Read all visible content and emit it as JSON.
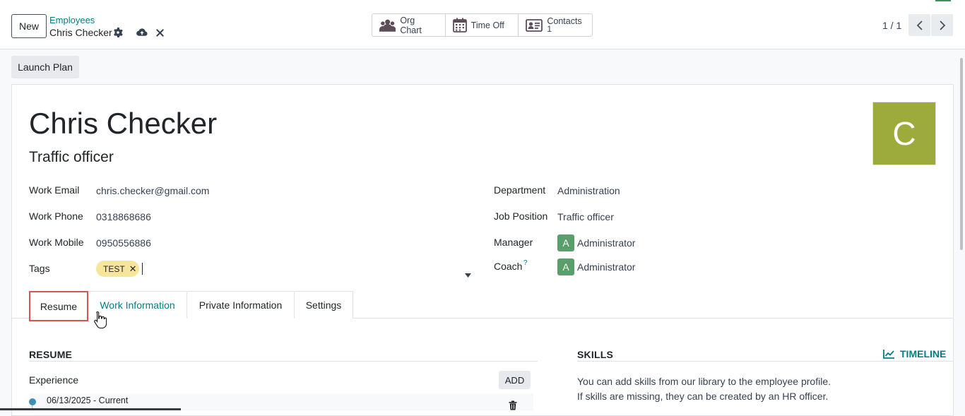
{
  "control_panel": {
    "new_label": "New",
    "breadcrumb_parent": "Employees",
    "breadcrumb_current": "Chris Checker",
    "smart_buttons": [
      {
        "label": "Org Chart",
        "icon": "users-icon"
      },
      {
        "label": "Time Off",
        "icon": "calendar-icon"
      },
      {
        "label": "Contacts",
        "count": "1",
        "icon": "id-card-icon"
      }
    ],
    "pager": "1 / 1"
  },
  "status_bar": {
    "launch_plan": "Launch Plan"
  },
  "employee": {
    "name": "Chris Checker",
    "job_title": "Traffic officer",
    "avatar_letter": "C",
    "avatar_color": "#9cab3c"
  },
  "fields_left": {
    "work_email_label": "Work Email",
    "work_email": "chris.checker@gmail.com",
    "work_phone_label": "Work Phone",
    "work_phone": "0318868686",
    "work_mobile_label": "Work Mobile",
    "work_mobile": "0950556886",
    "tags_label": "Tags",
    "tag": "TEST"
  },
  "fields_right": {
    "department_label": "Department",
    "department": "Administration",
    "job_position_label": "Job Position",
    "job_position": "Traffic officer",
    "manager_label": "Manager",
    "manager": "Administrator",
    "manager_initial": "A",
    "coach_label": "Coach",
    "coach_help": "?",
    "coach": "Administrator",
    "coach_initial": "A"
  },
  "tabs": [
    "Resume",
    "Work Information",
    "Private Information",
    "Settings"
  ],
  "resume": {
    "title": "RESUME",
    "experience_label": "Experience",
    "add_label": "ADD",
    "entry_date": "06/13/2025 - Current"
  },
  "skills": {
    "title": "SKILLS",
    "timeline_label": "TIMELINE",
    "line1": "You can add skills from our library to the employee profile.",
    "line2": "If skills are missing, they can be created by an HR officer."
  },
  "colors": {
    "accent": "#017e84",
    "highlight": "#d9534f",
    "tag": "#f7e59b"
  }
}
